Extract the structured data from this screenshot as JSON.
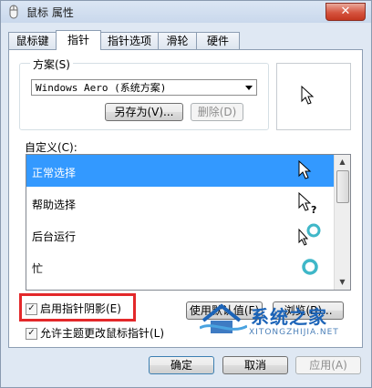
{
  "window": {
    "title": "鼠标 属性",
    "close_glyph": "✕"
  },
  "tabs": [
    {
      "label": "鼠标键"
    },
    {
      "label": "指针"
    },
    {
      "label": "指针选项"
    },
    {
      "label": "滑轮"
    },
    {
      "label": "硬件"
    }
  ],
  "scheme": {
    "label": "方案(S)",
    "selected": "Windows Aero (系统方案)",
    "save_as_label": "另存为(V)...",
    "delete_label": "删除(D)"
  },
  "customize": {
    "label": "自定义(C):",
    "items": [
      {
        "label": "正常选择",
        "icon": "arrow-cursor-icon",
        "selected": true
      },
      {
        "label": "帮助选择",
        "icon": "help-cursor-icon",
        "selected": false
      },
      {
        "label": "后台运行",
        "icon": "working-in-background-cursor-icon",
        "selected": false
      },
      {
        "label": "忙",
        "icon": "busy-cursor-icon",
        "selected": false
      }
    ]
  },
  "options": {
    "shadow_label": "启用指针阴影(E)",
    "shadow_checked": true,
    "theme_label": "允许主题更改鼠标指针(L)",
    "theme_checked": true,
    "use_default_label": "使用默认值(F)",
    "browse_label": "浏览(B)..."
  },
  "footer": {
    "ok_label": "确定",
    "cancel_label": "取消",
    "apply_label": "应用(A)"
  },
  "watermark": {
    "text": "系统之家",
    "domain": "XITONGZHIJIA.NET"
  },
  "colors": {
    "selection": "#3399ff",
    "highlight_frame": "#e3282a",
    "watermark": "#1c64b8"
  }
}
